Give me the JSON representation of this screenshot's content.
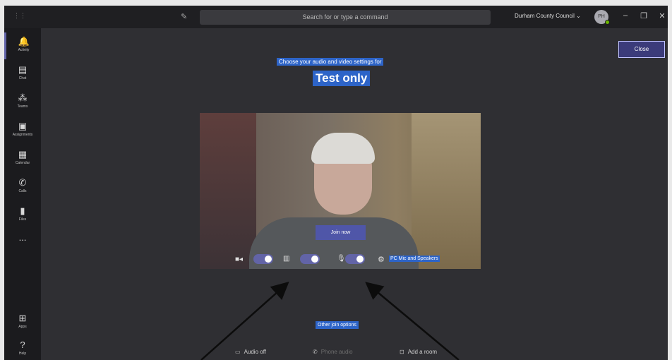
{
  "titlebar": {
    "search_placeholder": "Search for or type a command",
    "org_name": "Durham County Council ⌄",
    "avatar_initials": "PH",
    "minimize": "–",
    "restore": "❐",
    "close": "✕"
  },
  "rail": {
    "items": [
      {
        "label": "Activity",
        "icon": "bell-icon"
      },
      {
        "label": "Chat",
        "icon": "chat-icon"
      },
      {
        "label": "Teams",
        "icon": "teams-icon"
      },
      {
        "label": "Assignments",
        "icon": "assignments-icon"
      },
      {
        "label": "Calendar",
        "icon": "calendar-icon"
      },
      {
        "label": "Calls",
        "icon": "phone-icon"
      },
      {
        "label": "Files",
        "icon": "files-icon"
      },
      {
        "label": "...",
        "icon": "more-icon"
      },
      {
        "label": "Apps",
        "icon": "apps-icon"
      },
      {
        "label": "Help",
        "icon": "help-icon"
      }
    ]
  },
  "prejoin": {
    "close_label": "Close",
    "subtitle": "Choose your audio and video settings for",
    "meeting_title": "Test only",
    "blur_label": "Join now",
    "device_label": "PC Mic and Speakers",
    "other_join_options": "Other join options",
    "options": [
      {
        "label": "Audio off",
        "icon": "audio-off-icon"
      },
      {
        "label": "Phone audio",
        "icon": "phone-audio-icon"
      },
      {
        "label": "Add a room",
        "icon": "add-room-icon"
      }
    ]
  },
  "colors": {
    "accent": "#6264a7",
    "highlight": "#2d64c8",
    "background": "#2f2f33"
  }
}
